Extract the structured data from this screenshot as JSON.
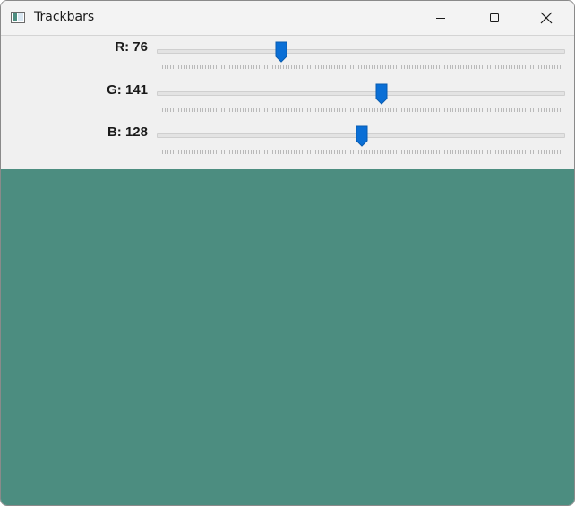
{
  "window": {
    "title": "Trackbars",
    "icon": "app-window-icon",
    "caption_buttons": [
      "minimize-icon",
      "maximize-icon",
      "close-icon"
    ]
  },
  "trackbars": [
    {
      "label": "R: 76",
      "value": 76,
      "max": 255
    },
    {
      "label": "G: 141",
      "value": 141,
      "max": 255
    },
    {
      "label": "B: 128",
      "value": 128,
      "max": 255
    }
  ],
  "preview": {
    "color": "#4c8d80"
  },
  "colors": {
    "thumb": "#0a6fd6",
    "track": "#e3e3e3",
    "background": "#f0f0f0"
  }
}
